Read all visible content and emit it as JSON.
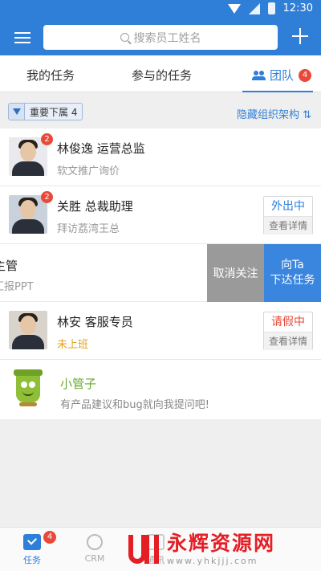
{
  "status_bar": {
    "time": "12:30"
  },
  "header": {
    "search_placeholder": "搜索员工姓名"
  },
  "tabs": {
    "mine": "我的任务",
    "joined": "参与的任务",
    "team": "团队",
    "team_badge": "4"
  },
  "filter": {
    "chip_label": "重要下属 4",
    "hide_org": "隐藏组织架构 ⇅"
  },
  "members": [
    {
      "avatar_badge": "2",
      "name": "林俊逸 运营总监",
      "task": "软文推广询价"
    },
    {
      "avatar_badge": "2",
      "name": "关胜 总裁助理",
      "task": "拜访荔湾王总",
      "status": "外出中",
      "detail": "查看详情"
    },
    {
      "name": "主管",
      "task": "汇报PPT",
      "actions": {
        "unfollow": "取消关注",
        "assign_line1": "向Ta",
        "assign_line2": "下达任务"
      }
    },
    {
      "name": "林安 客服专员",
      "task": "未上班",
      "status": "请假中",
      "detail": "查看详情"
    }
  ],
  "helper": {
    "name": "小管子",
    "message": "有产品建议和bug就向我提问吧!"
  },
  "bottom_nav": {
    "tasks": "任务",
    "tasks_badge": "4",
    "crm": "CRM",
    "third": "通讯"
  },
  "watermark": {
    "title": "永辉资源网",
    "url": "www.yhkjjj.com"
  },
  "colors": {
    "primary": "#2f7fd8",
    "badge": "#e84a3a",
    "warning": "#e3a11b",
    "helper_green": "#6aaa2e"
  }
}
